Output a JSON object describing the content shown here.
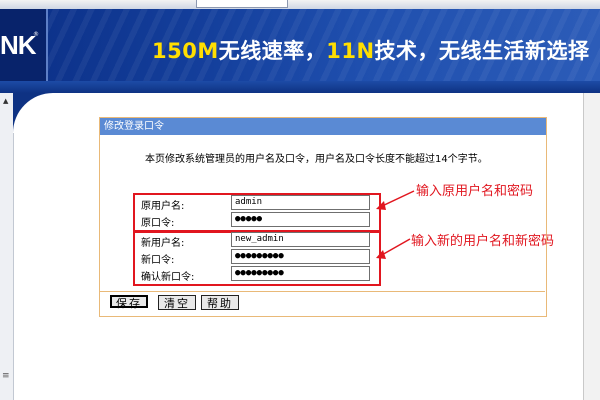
{
  "banner": {
    "logo": "NK",
    "logo_mark": "®",
    "slogan_part1": "150M",
    "slogan_part2": "无线速率，",
    "slogan_part3": "11N",
    "slogan_part4": "技术，无线生活新选择"
  },
  "panel": {
    "title": "修改登录口令",
    "intro": "本页修改系统管理员的用户名及口令，用户名及口令长度不能超过14个字节。"
  },
  "form": {
    "old_username_label": "原用户名:",
    "old_username_value": "admin",
    "old_password_label": "原口令:",
    "old_password_value": "●●●●●",
    "new_username_label": "新用户名:",
    "new_username_value": "new_admin",
    "new_password_label": "新口令:",
    "new_password_value": "●●●●●●●●●",
    "confirm_password_label": "确认新口令:",
    "confirm_password_value": "●●●●●●●●●"
  },
  "annotations": {
    "old_credentials": "输入原用户名和密码",
    "new_credentials": "输入新的用户名和新密码"
  },
  "buttons": {
    "save": "保存",
    "clear": "清空",
    "help": "帮助"
  },
  "colors": {
    "banner_blue": "#0e3283",
    "header_blue": "#5a8ad4",
    "panel_border": "#e9b978",
    "annotation_red": "#e1161f",
    "slogan_yellow": "#ffde00"
  },
  "icons": {
    "scroll_up": "scroll-up-arrow-icon",
    "scroll_grip": "scroll-grip-icon",
    "annotation_arrow": "red-arrow-icon"
  }
}
